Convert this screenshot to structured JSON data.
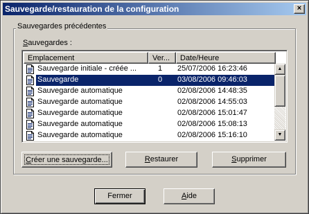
{
  "window": {
    "title": "Sauvegarde/restauration de la configuration",
    "close_glyph": "×"
  },
  "group": {
    "legend": "Sauvegardes précédentes",
    "list_label_prefix": "S",
    "list_label_rest": "auvegardes :"
  },
  "list": {
    "columns": [
      "Emplacement",
      "Ver...",
      "Date/Heure"
    ],
    "rows": [
      {
        "name": "Sauvegarde initiale - créée ...",
        "version": "1",
        "date": "25/07/2006 16:23:46",
        "selected": false
      },
      {
        "name": "Sauvegarde",
        "version": "0",
        "date": "03/08/2006 09:46:03",
        "selected": true
      },
      {
        "name": "Sauvegarde automatique",
        "version": "",
        "date": "02/08/2006 14:48:35",
        "selected": false
      },
      {
        "name": "Sauvegarde automatique",
        "version": "",
        "date": "02/08/2006 14:55:03",
        "selected": false
      },
      {
        "name": "Sauvegarde automatique",
        "version": "",
        "date": "02/08/2006 15:01:47",
        "selected": false
      },
      {
        "name": "Sauvegarde automatique",
        "version": "",
        "date": "02/08/2006 15:08:13",
        "selected": false
      },
      {
        "name": "Sauvegarde automatique",
        "version": "",
        "date": "02/08/2006 15:16:10",
        "selected": false
      }
    ],
    "row_icon": "document-icon",
    "scroll_up_glyph": "▲",
    "scroll_down_glyph": "▼"
  },
  "actions": {
    "create": {
      "prefix": "C",
      "rest": "réer une sauvegarde..."
    },
    "restore": {
      "prefix": "R",
      "rest": "estaurer"
    },
    "delete": {
      "prefix": "S",
      "rest": "upprimer"
    }
  },
  "footer": {
    "close_label": "Fermer",
    "help": {
      "prefix": "A",
      "rest": "ide"
    }
  },
  "colors": {
    "selection": "#0a246a",
    "title_gradient_start": "#0a246a",
    "title_gradient_end": "#a6caf0",
    "face": "#d4d0c8"
  }
}
